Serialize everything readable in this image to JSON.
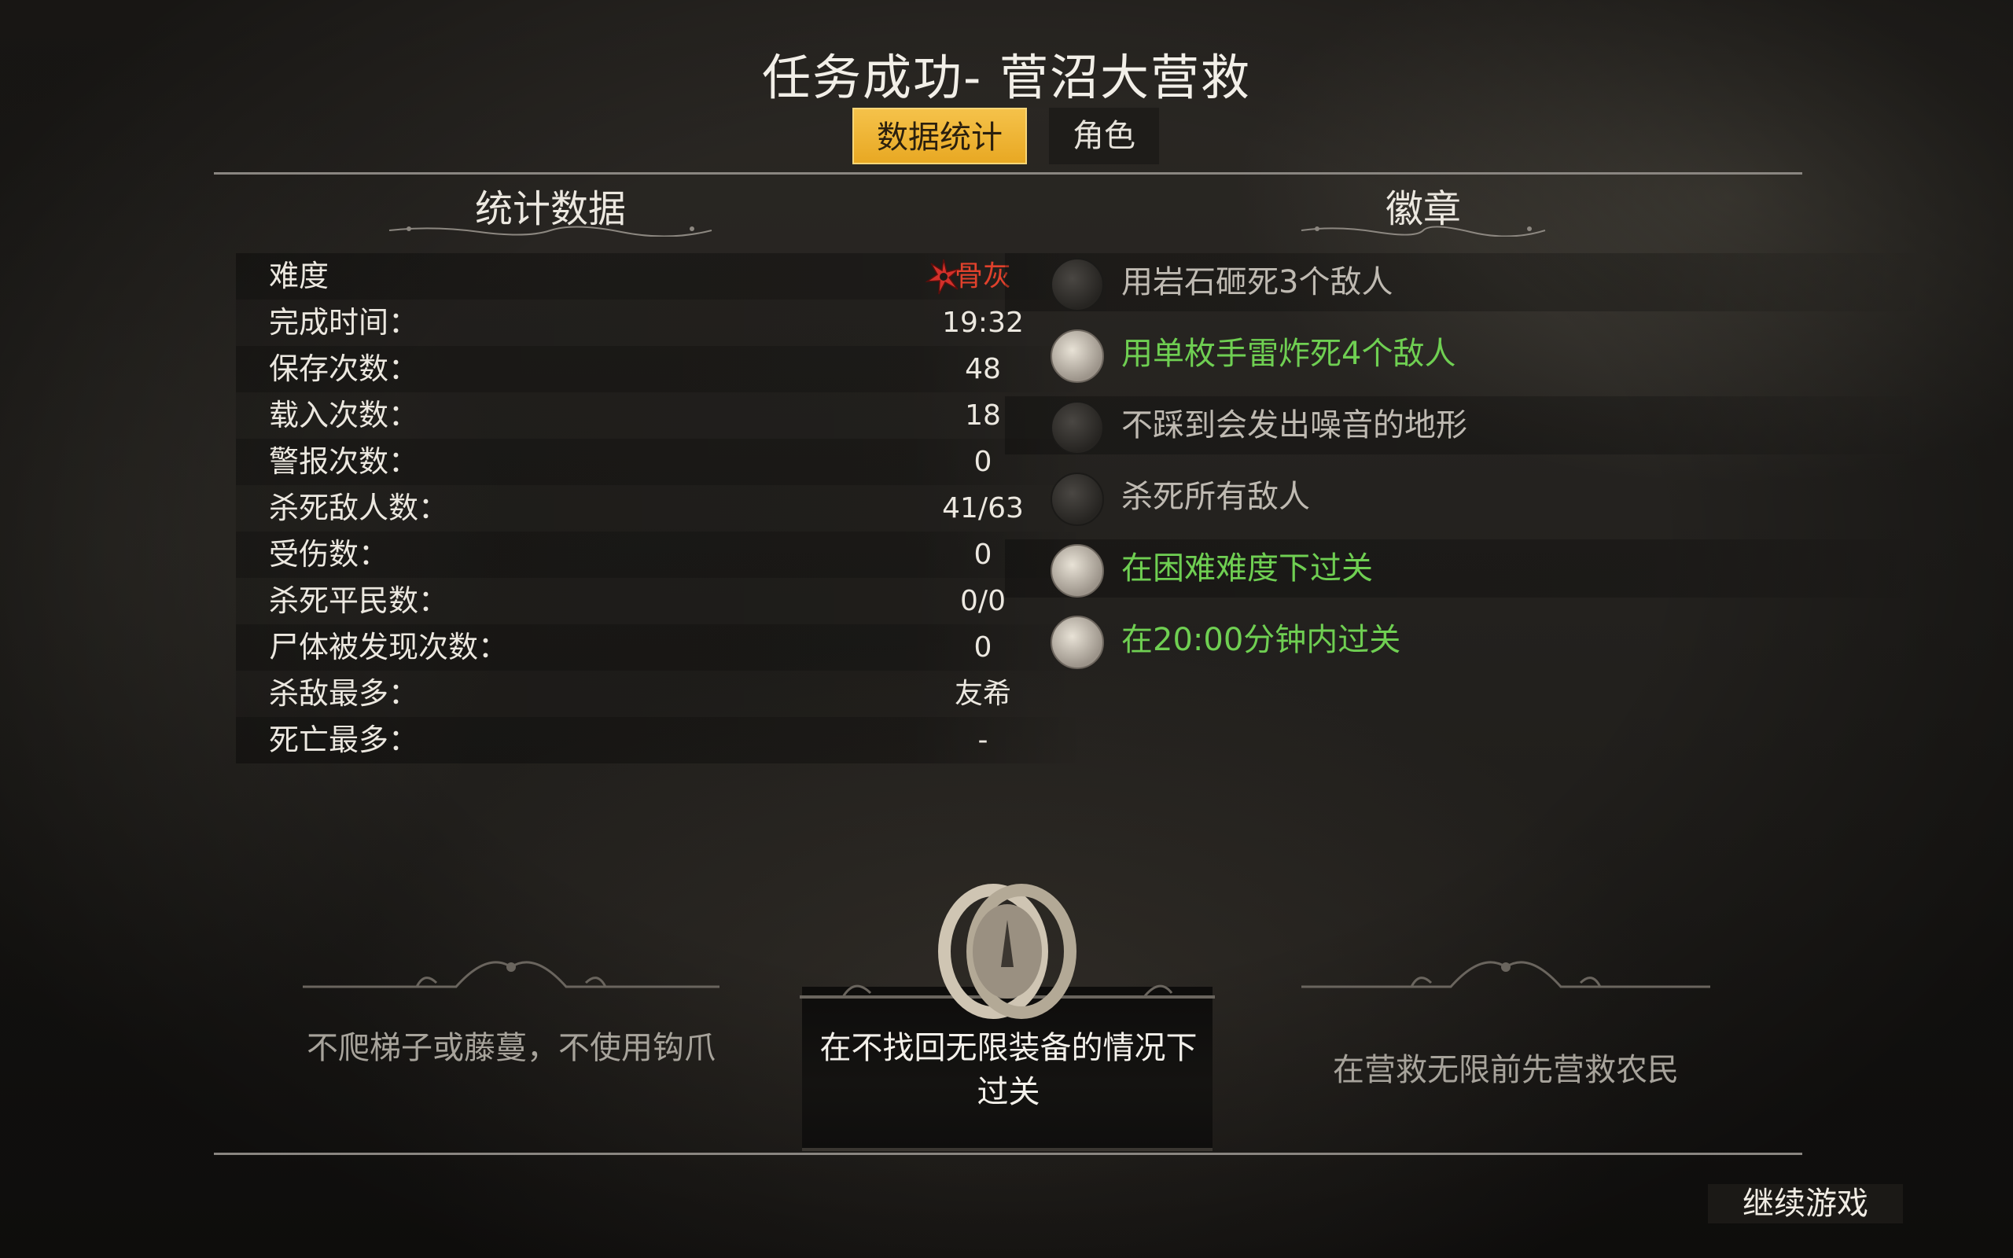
{
  "header": {
    "title": "任务成功- 菅沼大营救",
    "tabs": [
      {
        "label": "数据统计",
        "active": true
      },
      {
        "label": "角色",
        "active": false
      }
    ]
  },
  "stats": {
    "heading": "统计数据",
    "difficulty_label": "难度",
    "difficulty_value": "骨灰",
    "rows": [
      {
        "label": "完成时间：",
        "value": "19:32"
      },
      {
        "label": "保存次数：",
        "value": "48"
      },
      {
        "label": "载入次数：",
        "value": "18"
      },
      {
        "label": "警报次数：",
        "value": "0"
      },
      {
        "label": "杀死敌人数：",
        "value": "41/63"
      },
      {
        "label": "受伤数：",
        "value": "0"
      },
      {
        "label": "杀死平民数：",
        "value": "0/0"
      },
      {
        "label": "尸体被发现次数：",
        "value": "0"
      },
      {
        "label": "杀敌最多：",
        "value": "友希"
      },
      {
        "label": "死亡最多：",
        "value": "-"
      }
    ]
  },
  "badges": {
    "heading": "徽章",
    "items": [
      {
        "text": "用岩石砸死3个敌人",
        "earned": false
      },
      {
        "text": "用单枚手雷炸死4个敌人",
        "earned": true
      },
      {
        "text": "不踩到会发出噪音的地形",
        "earned": false
      },
      {
        "text": "杀死所有敌人",
        "earned": false
      },
      {
        "text": "在困难难度下过关",
        "earned": true
      },
      {
        "text": "在20:00分钟内过关",
        "earned": true
      }
    ]
  },
  "challenges": {
    "left": "不爬梯子或藤蔓，不使用钩爪",
    "middle": "在不找回无限装备的情况下过关",
    "right": "在营救无限前先营救农民"
  },
  "footer": {
    "continue_label": "继续游戏"
  },
  "colors": {
    "accent_tab": "#f0b535",
    "earned_green": "#6fcf52",
    "difficulty_red": "#e0412c"
  }
}
